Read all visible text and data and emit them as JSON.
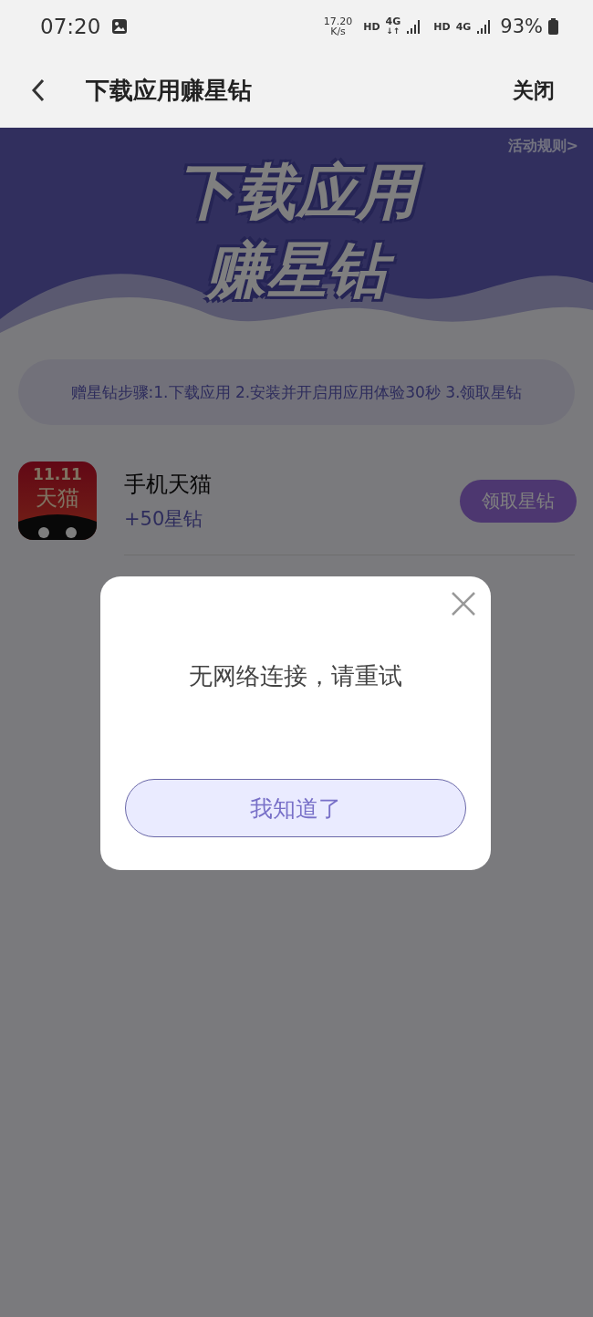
{
  "status_bar": {
    "time": "07:20",
    "speed": [
      "17.20",
      "K/s"
    ],
    "networks": [
      {
        "hd": "HD",
        "type": "4G",
        "arrows": "↓↑"
      },
      {
        "hd": "HD",
        "type": "4G"
      }
    ],
    "battery": "93%"
  },
  "header": {
    "title": "下载应用赚星钻",
    "close": "关闭"
  },
  "banner": {
    "rules_link": "活动规则>",
    "title_lines": [
      "下载应用",
      "赚星钻"
    ]
  },
  "steps": "赠星钻步骤:1.下载应用 2.安装并开启用应用体验30秒 3.领取星钻",
  "apps": [
    {
      "icon_text": [
        "11.11",
        "天猫"
      ],
      "name": "手机天猫",
      "reward": "+50星钻",
      "action": "领取星钻"
    }
  ],
  "dialog": {
    "message": "无网络连接，请重试",
    "button": "我知道了"
  }
}
